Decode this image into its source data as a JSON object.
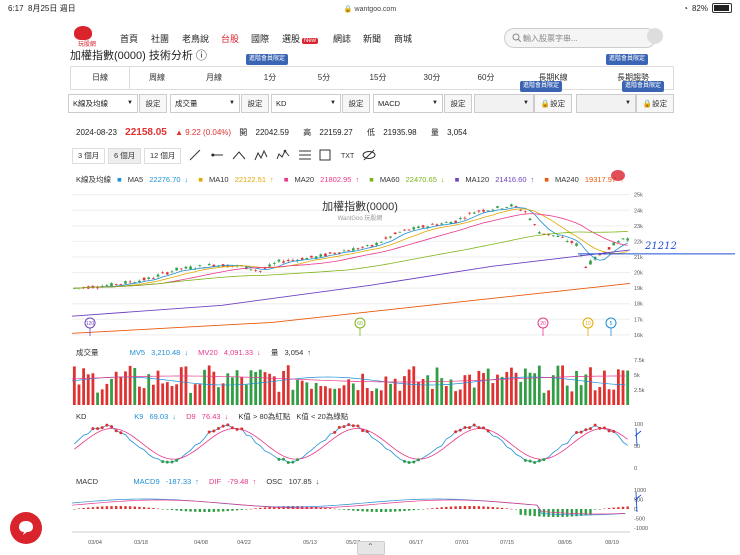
{
  "status": {
    "time": "6:17",
    "date": "8月25日 週日",
    "url": "wantgoo.com",
    "battery": "82%",
    "battery_level": 0.82
  },
  "header": {
    "logo_text": "玩股網",
    "nav": [
      "首頁",
      "社團",
      "老鳥說",
      "台股",
      "國際",
      "選股",
      "網誌",
      "新聞",
      "商城"
    ],
    "active_nav": "台股",
    "new_badge": "New",
    "search_placeholder": "輸入股票字串..."
  },
  "page_title": "加權指數(0000) 技術分析",
  "tabs": [
    {
      "label": "日線"
    },
    {
      "label": "周線"
    },
    {
      "label": "月線"
    },
    {
      "label": "1分"
    },
    {
      "label": "5分"
    },
    {
      "label": "15分"
    },
    {
      "label": "30分"
    },
    {
      "label": "60分"
    },
    {
      "label": "長期K線"
    },
    {
      "label": "長期趨勢"
    }
  ],
  "member_tag": "進階會員限定",
  "selectors": [
    {
      "value": "K線及均線",
      "button": "設定"
    },
    {
      "value": "成交量",
      "button": "設定"
    },
    {
      "value": "KD",
      "button": "設定"
    },
    {
      "value": "MACD",
      "button": "設定"
    },
    {
      "value": "",
      "button": "設定"
    },
    {
      "value": "",
      "button": "設定"
    }
  ],
  "quote": {
    "date": "2024-08-23",
    "price": "22158.05",
    "change": "▲ 9.22 (0.04%)",
    "open_label": "開",
    "open": "22042.59",
    "high_label": "高",
    "high": "22159.27",
    "low_label": "低",
    "low": "21935.98",
    "vol_label": "量",
    "volume": "3,054"
  },
  "ranges": [
    "3 個月",
    "6 個月",
    "12 個月"
  ],
  "selected_range": "6 個月",
  "kline_legend": {
    "label": "K線及均線",
    "items": [
      {
        "text": "MA5",
        "value": "22276.70",
        "arrow": "↓",
        "color": "#1f8fd6"
      },
      {
        "text": "MA10",
        "value": "22122.51",
        "arrow": "↑",
        "color": "#e0a800"
      },
      {
        "text": "MA20",
        "value": "21802.95",
        "arrow": "↑",
        "color": "#e8388a"
      },
      {
        "text": "MA60",
        "value": "22470.65",
        "arrow": "↓",
        "color": "#7cb518"
      },
      {
        "text": "MA120",
        "value": "21416.60",
        "arrow": "↑",
        "color": "#6f42c1"
      },
      {
        "text": "MA240",
        "value": "19317.97",
        "arrow": "↑",
        "color": "#e8590c"
      }
    ]
  },
  "chart_title": "加權指數(0000)",
  "chart_watermark": "WantGoo 玩股網",
  "handwritten_note": "21212",
  "kline_axis": [
    "25k",
    "24k",
    "23k",
    "22k",
    "21k",
    "20k",
    "19k",
    "18k",
    "17k",
    "16k"
  ],
  "ma_markers": [
    "120",
    "60",
    "20",
    "10",
    "5"
  ],
  "volume_legend": {
    "label": "成交量",
    "items": [
      {
        "text": "MV5",
        "value": "3,210.48",
        "arrow": "↓",
        "color": "#1f8fd6"
      },
      {
        "text": "MV20",
        "value": "4,091.33",
        "arrow": "↓",
        "color": "#e8388a"
      },
      {
        "text": "量",
        "value": "3,054",
        "arrow": "↑",
        "color": "#222"
      }
    ]
  },
  "volume_axis": [
    "7.5k",
    "5k",
    "2.5k"
  ],
  "kd_legend": {
    "label": "KD",
    "items": [
      {
        "text": "K9",
        "value": "69.03",
        "arrow": "↓",
        "color": "#1f8fd6"
      },
      {
        "text": "D9",
        "value": "76.43",
        "arrow": "↓",
        "color": "#e8388a"
      },
      {
        "text": "K值 > 80為紅點",
        "value": "",
        "arrow": "",
        "color": "#222"
      },
      {
        "text": "K值 < 20為綠點",
        "value": "",
        "arrow": "",
        "color": "#222"
      }
    ]
  },
  "kd_axis": [
    "100",
    "50",
    "0"
  ],
  "macd_legend": {
    "label": "MACD",
    "items": [
      {
        "text": "MACD9",
        "value": "-187.33",
        "arrow": "↑",
        "color": "#1f8fd6"
      },
      {
        "text": "DIF",
        "value": "-79.48",
        "arrow": "↑",
        "color": "#e8388a"
      },
      {
        "text": "OSC",
        "value": "107.85",
        "arrow": "↓",
        "color": "#222"
      }
    ]
  },
  "macd_axis": [
    "1000",
    "500",
    "0",
    "-500",
    "-1000"
  ],
  "x_dates": [
    "03/04",
    "03/18",
    "04/08",
    "04/22",
    "05/13",
    "05/27",
    "06/17",
    "07/01",
    "07/15",
    "08/05",
    "08/19"
  ]
}
